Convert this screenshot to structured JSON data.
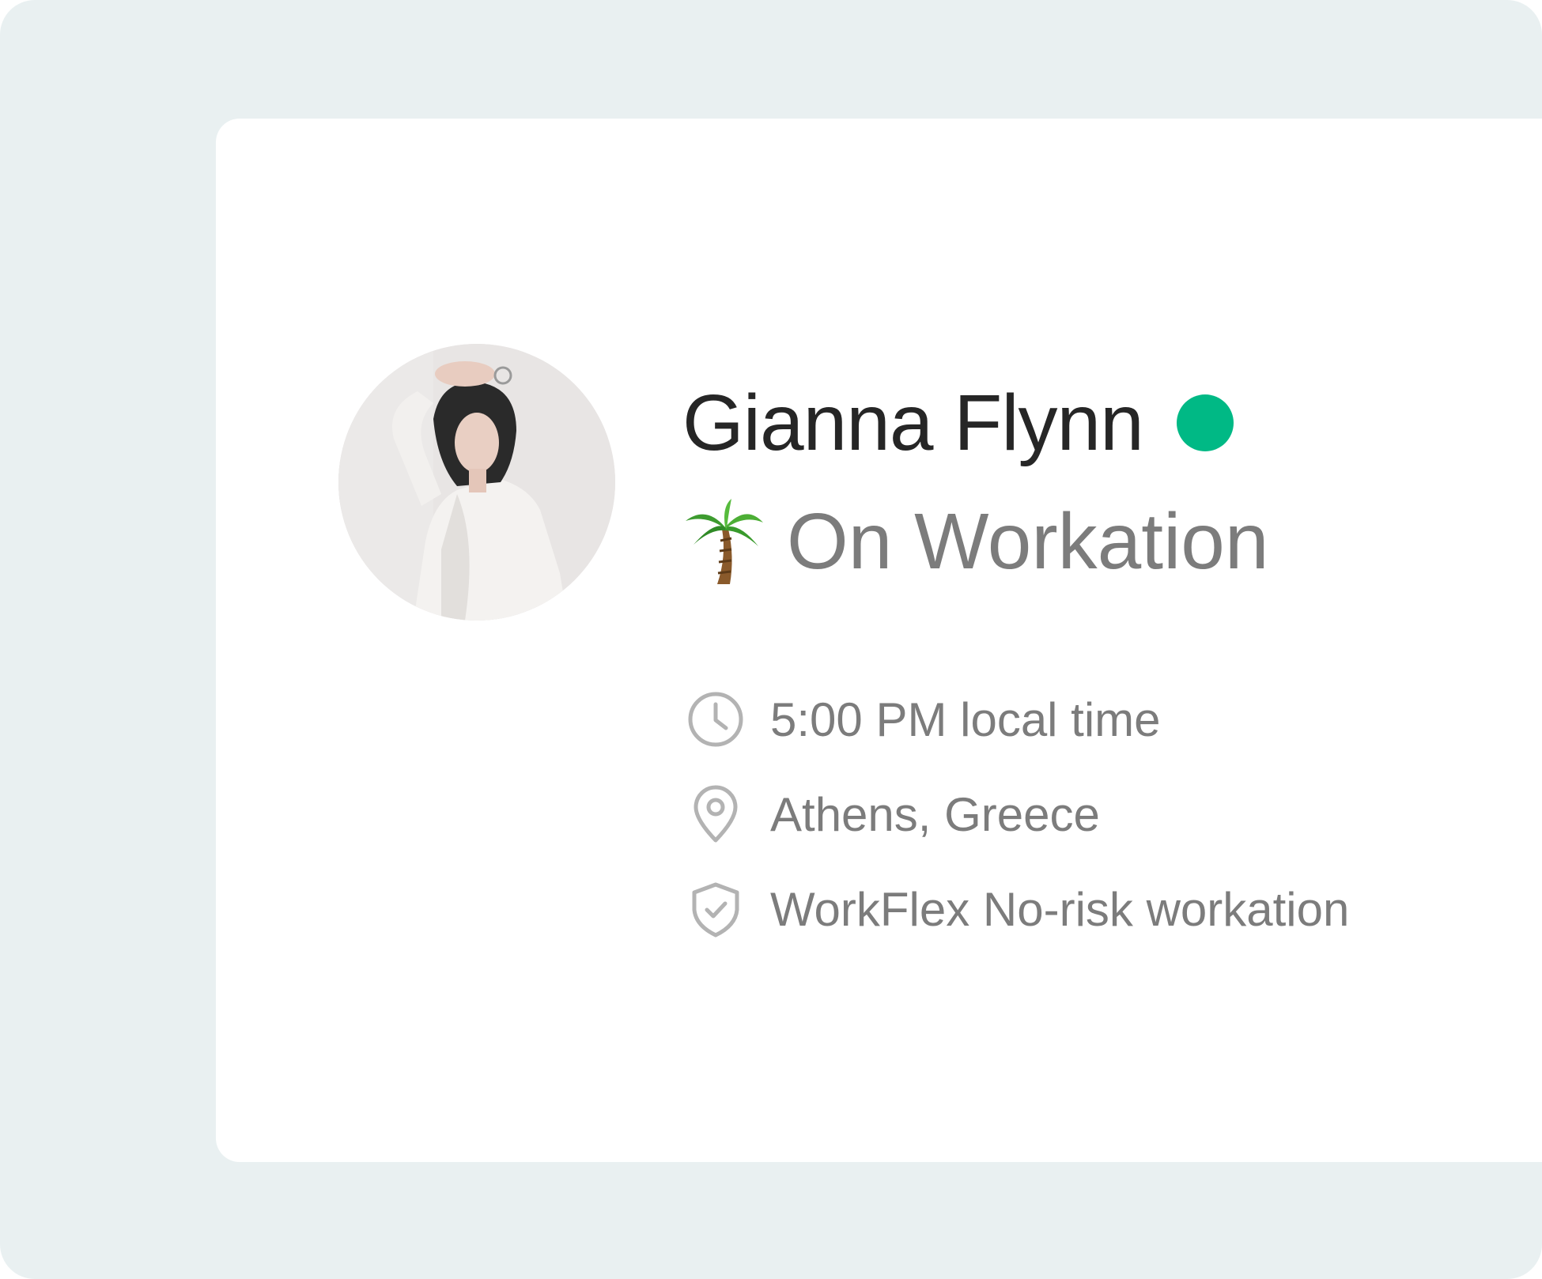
{
  "profile": {
    "name": "Gianna Flynn",
    "status": {
      "label": "On Workation",
      "icon": "palm-tree-icon",
      "online_color": "#00b985"
    },
    "details": [
      {
        "icon": "clock-icon",
        "text": "5:00 PM local time"
      },
      {
        "icon": "location-pin-icon",
        "text": "Athens, Greece"
      },
      {
        "icon": "shield-check-icon",
        "text": "WorkFlex No-risk workation"
      }
    ]
  },
  "colors": {
    "background": "#e9f0f1",
    "card": "#ffffff",
    "name_text": "#262626",
    "secondary_text": "#7c7c7c",
    "icon_stroke": "#b3b3b3",
    "online": "#00b985"
  }
}
